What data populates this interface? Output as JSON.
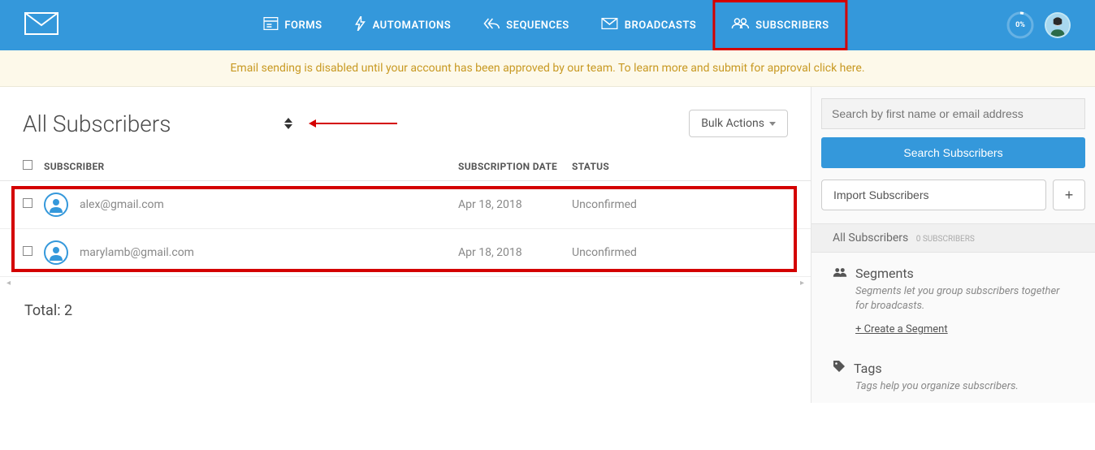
{
  "nav": {
    "items": [
      {
        "label": "FORMS"
      },
      {
        "label": "AUTOMATIONS"
      },
      {
        "label": "SEQUENCES"
      },
      {
        "label": "BROADCASTS"
      },
      {
        "label": "SUBSCRIBERS"
      }
    ],
    "progress": "0%"
  },
  "alert": {
    "text": "Email sending is disabled until your account has been approved by our team. To learn more and submit for approval click here."
  },
  "page": {
    "title": "All Subscribers",
    "bulkActionsLabel": "Bulk Actions",
    "totalLabel": "Total: 2"
  },
  "columns": {
    "subscriber": "SUBSCRIBER",
    "date": "SUBSCRIPTION DATE",
    "status": "STATUS"
  },
  "rows": [
    {
      "email": "alex@gmail.com",
      "date": "Apr 18, 2018",
      "status": "Unconfirmed"
    },
    {
      "email": "marylamb@gmail.com",
      "date": "Apr 18, 2018",
      "status": "Unconfirmed"
    }
  ],
  "sidebar": {
    "searchPlaceholder": "Search by first name or email address",
    "searchButton": "Search Subscribers",
    "importButton": "Import Subscribers",
    "plusButton": "+",
    "allSubsLabel": "All Subscribers",
    "allSubsCount": "0 SUBSCRIBERS",
    "segments": {
      "title": "Segments",
      "desc": "Segments let you group subscribers together for broadcasts.",
      "link": "+ Create a Segment"
    },
    "tags": {
      "title": "Tags",
      "desc": "Tags help you organize subscribers."
    }
  }
}
